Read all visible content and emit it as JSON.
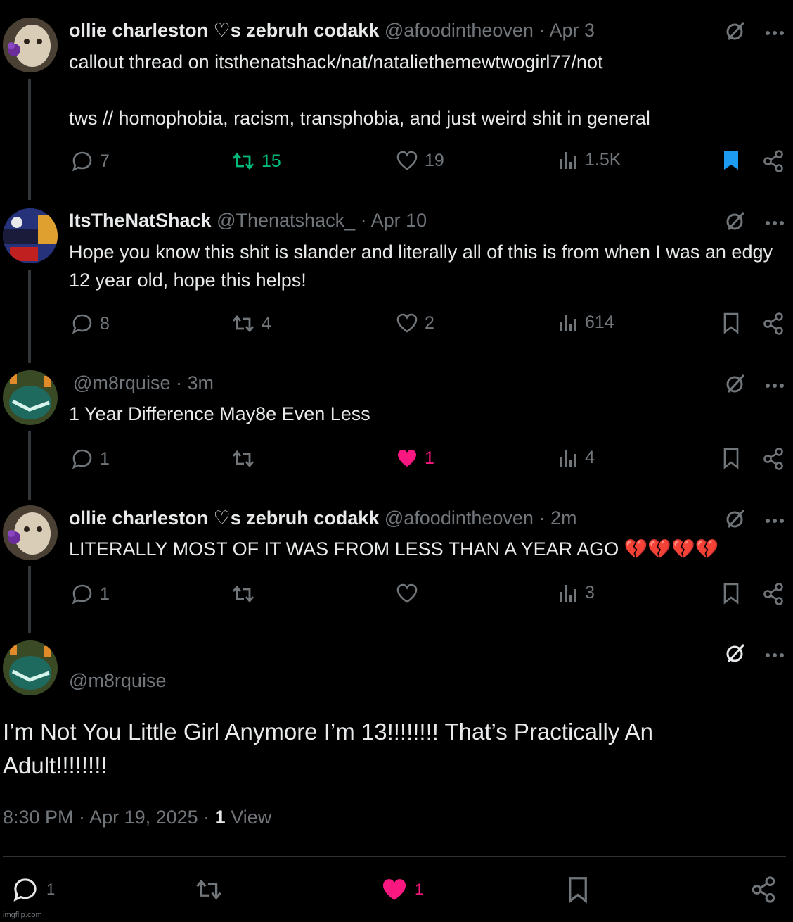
{
  "colors": {
    "background": "#000000",
    "text": "#e7e9ea",
    "muted": "#71767b",
    "retweet_green": "#00ba7c",
    "like_pink": "#f91880",
    "bookmark_blue": "#1d9bf0",
    "divider": "#2f3336"
  },
  "posts": [
    {
      "name": "ollie charleston ♡s zebruh codakk",
      "handle": "@afoodintheoven",
      "time": "· Apr 3",
      "text": "callout thread on itsthenatshack/nat/nataliethemewtwogirl77/not\n\ntws // homophobia, racism, transphobia, and just weird shit in general",
      "replies": "7",
      "retweets": "15",
      "likes": "19",
      "views": "1.5K",
      "retweeted": true,
      "bookmarked": true
    },
    {
      "name": "ItsTheNatShack",
      "handle": "@Thenatshack_",
      "time": "· Apr 10",
      "text": "Hope you know this shit is slander and literally all of this is from when I was an edgy 12 year old, hope this helps!",
      "replies": "8",
      "retweets": "4",
      "likes": "2",
      "views": "614"
    },
    {
      "name": "",
      "handle": "@m8rquise",
      "time": "· 3m",
      "text": "1 Year Difference May8e Even Less",
      "replies": "1",
      "retweets": "",
      "likes": "1",
      "views": "4",
      "liked": true
    },
    {
      "name": "ollie charleston ♡s zebruh codakk",
      "handle": "@afoodintheoven",
      "time": "· 2m",
      "text": "LITERALLY MOST OF IT WAS FROM LESS THAN A YEAR AGO 💔💔💔💔",
      "replies": "1",
      "retweets": "",
      "likes": "",
      "views": "3"
    }
  ],
  "main_post": {
    "handle": "@m8rquise",
    "text": "I’m Not You Little Girl Anymore I’m 13!!!!!!!! That’s Practically An Adult!!!!!!!!",
    "timestamp": "8:30 PM · Apr 19, 2025 · ",
    "view_count": "1",
    "view_label": "View",
    "replies": "1",
    "likes": "1"
  },
  "watermark": "imgflip.com"
}
